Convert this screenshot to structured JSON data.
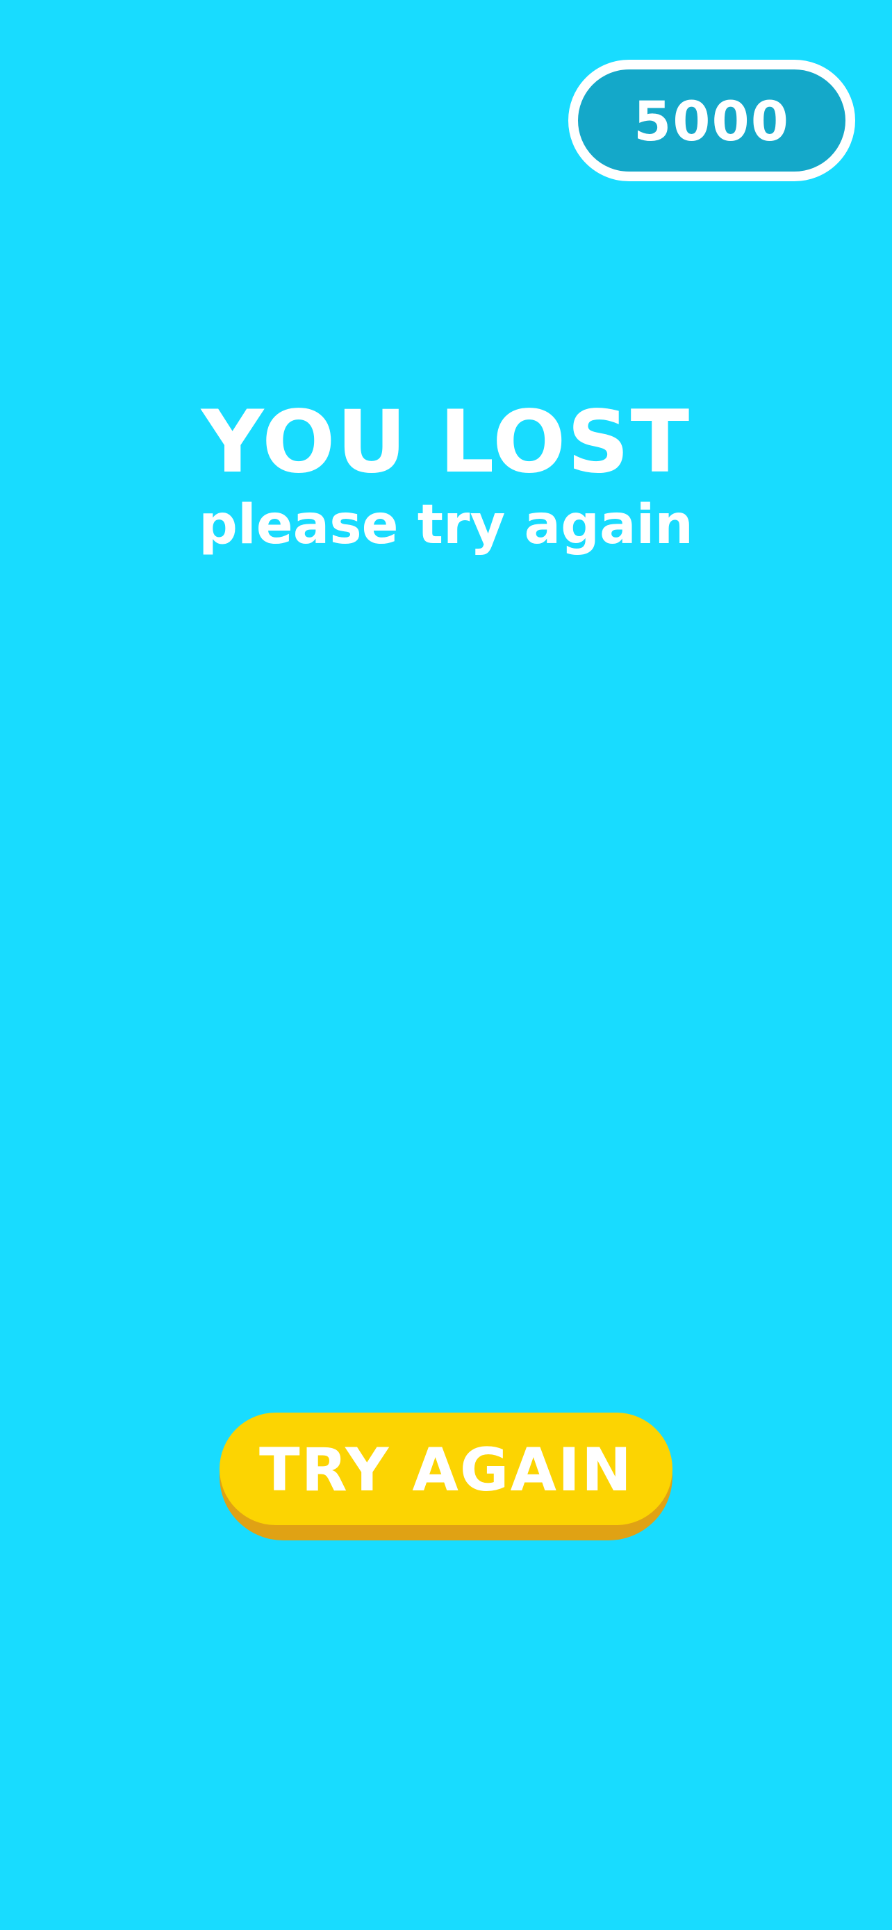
{
  "colors": {
    "background": "#18DCFF",
    "score_pill_fill": "#14A8C9",
    "score_pill_border": "#FFFFFF",
    "button_face": "#FCD402",
    "button_shadow": "#E0A214",
    "text": "#FFFFFF"
  },
  "score": {
    "value": "5000"
  },
  "result": {
    "title": "YOU LOST",
    "subtitle": "please try again"
  },
  "actions": {
    "try_again_label": "TRY AGAIN"
  }
}
